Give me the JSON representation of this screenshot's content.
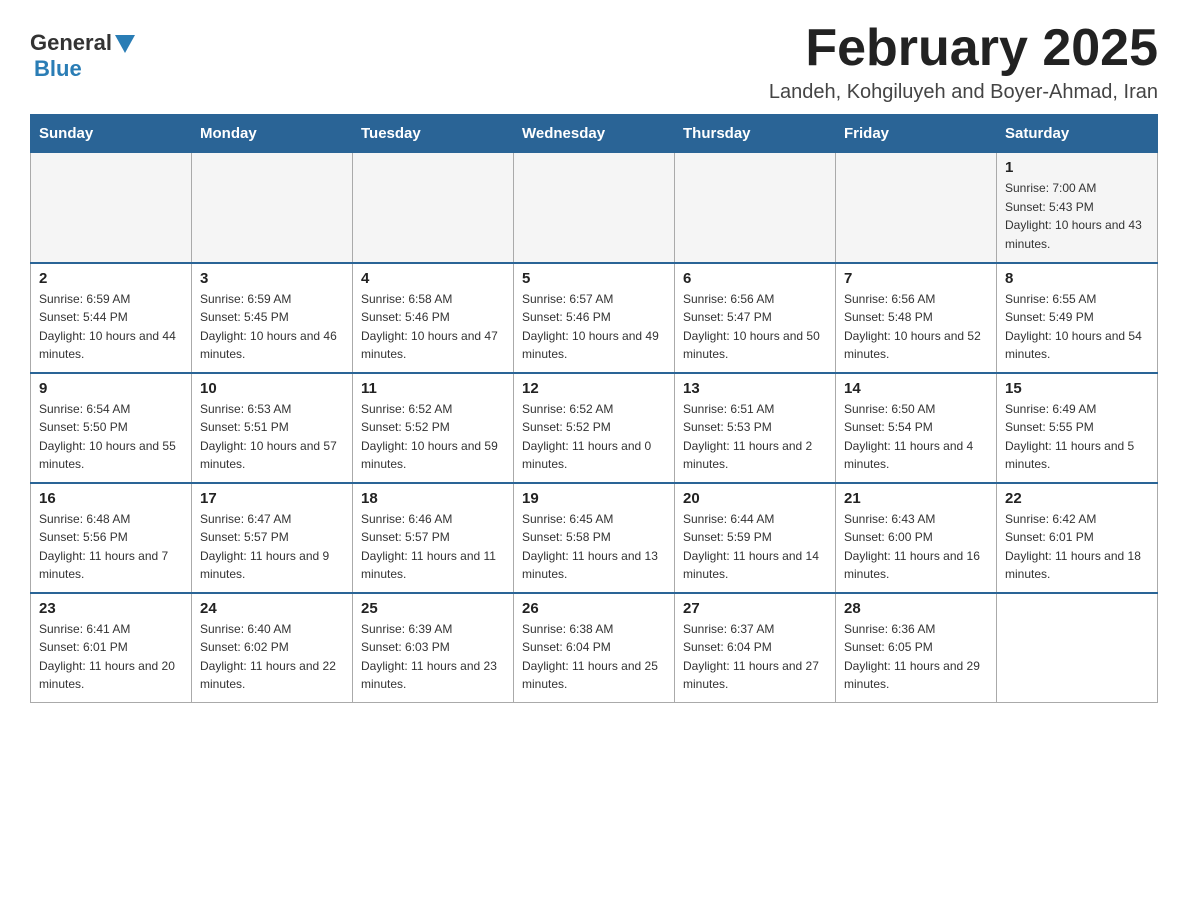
{
  "header": {
    "logo_general": "General",
    "logo_blue": "Blue",
    "month_title": "February 2025",
    "location": "Landeh, Kohgiluyeh and Boyer-Ahmad, Iran"
  },
  "weekdays": [
    "Sunday",
    "Monday",
    "Tuesday",
    "Wednesday",
    "Thursday",
    "Friday",
    "Saturday"
  ],
  "weeks": [
    [
      {
        "day": "",
        "sunrise": "",
        "sunset": "",
        "daylight": ""
      },
      {
        "day": "",
        "sunrise": "",
        "sunset": "",
        "daylight": ""
      },
      {
        "day": "",
        "sunrise": "",
        "sunset": "",
        "daylight": ""
      },
      {
        "day": "",
        "sunrise": "",
        "sunset": "",
        "daylight": ""
      },
      {
        "day": "",
        "sunrise": "",
        "sunset": "",
        "daylight": ""
      },
      {
        "day": "",
        "sunrise": "",
        "sunset": "",
        "daylight": ""
      },
      {
        "day": "1",
        "sunrise": "Sunrise: 7:00 AM",
        "sunset": "Sunset: 5:43 PM",
        "daylight": "Daylight: 10 hours and 43 minutes."
      }
    ],
    [
      {
        "day": "2",
        "sunrise": "Sunrise: 6:59 AM",
        "sunset": "Sunset: 5:44 PM",
        "daylight": "Daylight: 10 hours and 44 minutes."
      },
      {
        "day": "3",
        "sunrise": "Sunrise: 6:59 AM",
        "sunset": "Sunset: 5:45 PM",
        "daylight": "Daylight: 10 hours and 46 minutes."
      },
      {
        "day": "4",
        "sunrise": "Sunrise: 6:58 AM",
        "sunset": "Sunset: 5:46 PM",
        "daylight": "Daylight: 10 hours and 47 minutes."
      },
      {
        "day": "5",
        "sunrise": "Sunrise: 6:57 AM",
        "sunset": "Sunset: 5:46 PM",
        "daylight": "Daylight: 10 hours and 49 minutes."
      },
      {
        "day": "6",
        "sunrise": "Sunrise: 6:56 AM",
        "sunset": "Sunset: 5:47 PM",
        "daylight": "Daylight: 10 hours and 50 minutes."
      },
      {
        "day": "7",
        "sunrise": "Sunrise: 6:56 AM",
        "sunset": "Sunset: 5:48 PM",
        "daylight": "Daylight: 10 hours and 52 minutes."
      },
      {
        "day": "8",
        "sunrise": "Sunrise: 6:55 AM",
        "sunset": "Sunset: 5:49 PM",
        "daylight": "Daylight: 10 hours and 54 minutes."
      }
    ],
    [
      {
        "day": "9",
        "sunrise": "Sunrise: 6:54 AM",
        "sunset": "Sunset: 5:50 PM",
        "daylight": "Daylight: 10 hours and 55 minutes."
      },
      {
        "day": "10",
        "sunrise": "Sunrise: 6:53 AM",
        "sunset": "Sunset: 5:51 PM",
        "daylight": "Daylight: 10 hours and 57 minutes."
      },
      {
        "day": "11",
        "sunrise": "Sunrise: 6:52 AM",
        "sunset": "Sunset: 5:52 PM",
        "daylight": "Daylight: 10 hours and 59 minutes."
      },
      {
        "day": "12",
        "sunrise": "Sunrise: 6:52 AM",
        "sunset": "Sunset: 5:52 PM",
        "daylight": "Daylight: 11 hours and 0 minutes."
      },
      {
        "day": "13",
        "sunrise": "Sunrise: 6:51 AM",
        "sunset": "Sunset: 5:53 PM",
        "daylight": "Daylight: 11 hours and 2 minutes."
      },
      {
        "day": "14",
        "sunrise": "Sunrise: 6:50 AM",
        "sunset": "Sunset: 5:54 PM",
        "daylight": "Daylight: 11 hours and 4 minutes."
      },
      {
        "day": "15",
        "sunrise": "Sunrise: 6:49 AM",
        "sunset": "Sunset: 5:55 PM",
        "daylight": "Daylight: 11 hours and 5 minutes."
      }
    ],
    [
      {
        "day": "16",
        "sunrise": "Sunrise: 6:48 AM",
        "sunset": "Sunset: 5:56 PM",
        "daylight": "Daylight: 11 hours and 7 minutes."
      },
      {
        "day": "17",
        "sunrise": "Sunrise: 6:47 AM",
        "sunset": "Sunset: 5:57 PM",
        "daylight": "Daylight: 11 hours and 9 minutes."
      },
      {
        "day": "18",
        "sunrise": "Sunrise: 6:46 AM",
        "sunset": "Sunset: 5:57 PM",
        "daylight": "Daylight: 11 hours and 11 minutes."
      },
      {
        "day": "19",
        "sunrise": "Sunrise: 6:45 AM",
        "sunset": "Sunset: 5:58 PM",
        "daylight": "Daylight: 11 hours and 13 minutes."
      },
      {
        "day": "20",
        "sunrise": "Sunrise: 6:44 AM",
        "sunset": "Sunset: 5:59 PM",
        "daylight": "Daylight: 11 hours and 14 minutes."
      },
      {
        "day": "21",
        "sunrise": "Sunrise: 6:43 AM",
        "sunset": "Sunset: 6:00 PM",
        "daylight": "Daylight: 11 hours and 16 minutes."
      },
      {
        "day": "22",
        "sunrise": "Sunrise: 6:42 AM",
        "sunset": "Sunset: 6:01 PM",
        "daylight": "Daylight: 11 hours and 18 minutes."
      }
    ],
    [
      {
        "day": "23",
        "sunrise": "Sunrise: 6:41 AM",
        "sunset": "Sunset: 6:01 PM",
        "daylight": "Daylight: 11 hours and 20 minutes."
      },
      {
        "day": "24",
        "sunrise": "Sunrise: 6:40 AM",
        "sunset": "Sunset: 6:02 PM",
        "daylight": "Daylight: 11 hours and 22 minutes."
      },
      {
        "day": "25",
        "sunrise": "Sunrise: 6:39 AM",
        "sunset": "Sunset: 6:03 PM",
        "daylight": "Daylight: 11 hours and 23 minutes."
      },
      {
        "day": "26",
        "sunrise": "Sunrise: 6:38 AM",
        "sunset": "Sunset: 6:04 PM",
        "daylight": "Daylight: 11 hours and 25 minutes."
      },
      {
        "day": "27",
        "sunrise": "Sunrise: 6:37 AM",
        "sunset": "Sunset: 6:04 PM",
        "daylight": "Daylight: 11 hours and 27 minutes."
      },
      {
        "day": "28",
        "sunrise": "Sunrise: 6:36 AM",
        "sunset": "Sunset: 6:05 PM",
        "daylight": "Daylight: 11 hours and 29 minutes."
      },
      {
        "day": "",
        "sunrise": "",
        "sunset": "",
        "daylight": ""
      }
    ]
  ]
}
